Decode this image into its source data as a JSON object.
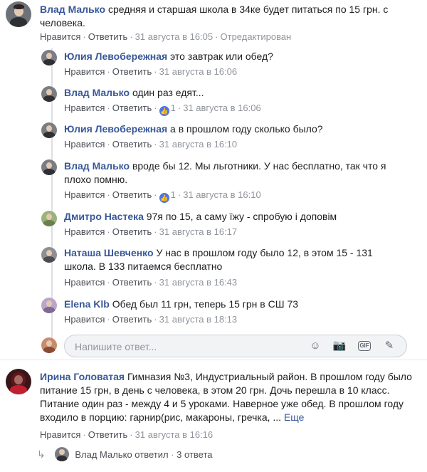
{
  "comments": [
    {
      "author": "Влад Малько",
      "text": "средняя и старшая школа в 34ке будет питаться по 15 грн. с человека.",
      "like": "Нравится",
      "reply": "Ответить",
      "time": "31 августа в 16:05",
      "edited": "Отредактирован"
    },
    {
      "author": "Юлия Левобережная",
      "text": "это завтрак или обед?",
      "like": "Нравится",
      "reply": "Ответить",
      "time": "31 августа в 16:06"
    },
    {
      "author": "Влад Малько",
      "text": "один раз едят...",
      "like": "Нравится",
      "reply": "Ответить",
      "likes": "1",
      "time": "31 августа в 16:06"
    },
    {
      "author": "Юлия Левобережная",
      "text": "а в прошлом году сколько было?",
      "like": "Нравится",
      "reply": "Ответить",
      "time": "31 августа в 16:10"
    },
    {
      "author": "Влад Малько",
      "text": "вроде бы 12. Мы льготники. У нас бесплатно, так что я плохо помню.",
      "like": "Нравится",
      "reply": "Ответить",
      "likes": "1",
      "time": "31 августа в 16:10"
    },
    {
      "author": "Дмитро Настека",
      "text": "97я по 15, а саму їжу - спробую і доповім",
      "like": "Нравится",
      "reply": "Ответить",
      "time": "31 августа в 16:17"
    },
    {
      "author": "Наташа Шевченко",
      "text": "У нас в прошлом году было 12, в этом 15 - 131 школа. В 133 питаемся бесплатно",
      "like": "Нравится",
      "reply": "Ответить",
      "time": "31 августа в 16:43"
    },
    {
      "author": "Elena Klb",
      "text": "Обед был 11 грн, теперь 15 грн в СШ 73",
      "like": "Нравится",
      "reply": "Ответить",
      "time": "31 августа в 18:13"
    },
    {
      "author": "Ирина Головатая",
      "text": "Гимназия №3, Индустриальный район. В прошлом году было питание 15 грн, в день с человека, в этом 20 грн. Дочь перешла в 10 класс. Питание один раз - между 4 и 5 уроками. Наверное уже обед. В прошлом году входило в порцию: гарнир(рис, макароны, гречка, ...",
      "more": "Еще",
      "like": "Нравится",
      "reply": "Ответить",
      "time": "31 августа в 16:16"
    }
  ],
  "reply_box": {
    "placeholder": "Напишите ответ..."
  },
  "replies_summary": {
    "author": "Влад Малько",
    "text": "ответил",
    "count": "3 ответа"
  },
  "colors": {
    "name": "#385898",
    "meta": "#90949c",
    "like_badge": "#4a76e8"
  }
}
